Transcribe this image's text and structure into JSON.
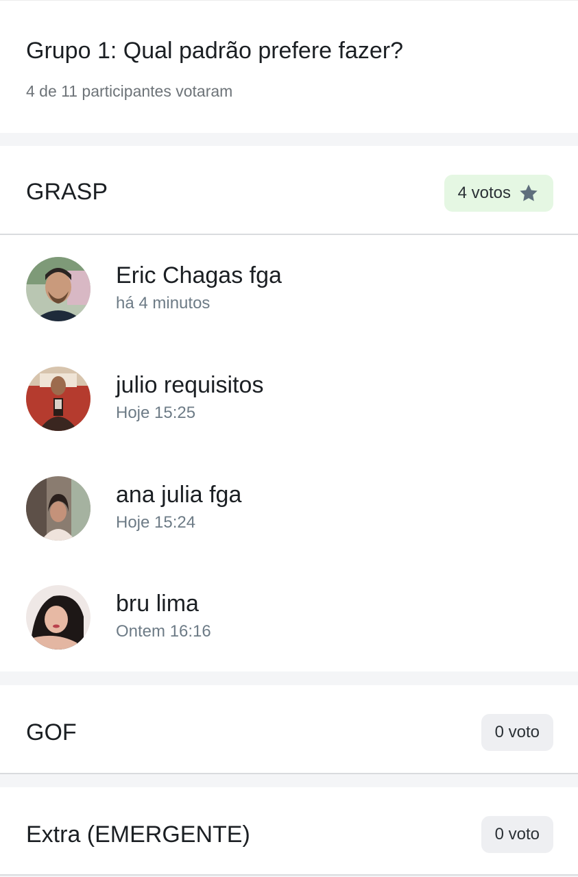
{
  "poll": {
    "title": "Grupo 1: Qual padrão prefere fazer?",
    "subtitle": "4 de 11 participantes votaram"
  },
  "options": [
    {
      "name": "GRASP",
      "votes_label": "4 votos",
      "votes": 4,
      "winner": true,
      "icon": "star-icon",
      "voters": [
        {
          "name": "Eric Chagas fga",
          "time": "há 4 minutos"
        },
        {
          "name": "julio requisitos",
          "time": "Hoje 15:25"
        },
        {
          "name": "ana julia fga",
          "time": "Hoje 15:24"
        },
        {
          "name": "bru lima",
          "time": "Ontem 16:16"
        }
      ]
    },
    {
      "name": "GOF",
      "votes_label": "0 voto",
      "votes": 0,
      "winner": false,
      "voters": []
    },
    {
      "name": "Extra (EMERGENTE)",
      "votes_label": "0 voto",
      "votes": 0,
      "winner": false,
      "voters": []
    }
  ],
  "colors": {
    "winner_badge": "#e5f7e3",
    "plain_badge": "#eeeff2",
    "star": "#5f6f7d",
    "separator": "#f4f5f7"
  }
}
